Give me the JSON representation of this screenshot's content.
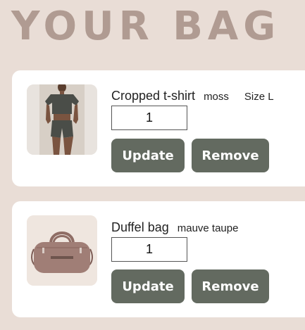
{
  "page": {
    "title": "YOUR BAG"
  },
  "cart": {
    "items": [
      {
        "name": "Cropped t-shirt",
        "variant": "moss",
        "size": "Size L",
        "quantity": "1",
        "update_label": "Update",
        "remove_label": "Remove",
        "image_icon": "model-wearing-cropped-tshirt-photo"
      },
      {
        "name": "Duffel bag",
        "variant": "mauve taupe",
        "quantity": "1",
        "update_label": "Update",
        "remove_label": "Remove",
        "image_icon": "duffel-bag-photo"
      }
    ]
  },
  "colors": {
    "background": "#e9ddd6",
    "title": "#b09b92",
    "card": "#ffffff",
    "button": "#636a60",
    "button_text": "#ffffff",
    "tshirt": "#4a4d48",
    "bag": "#a07e76"
  }
}
